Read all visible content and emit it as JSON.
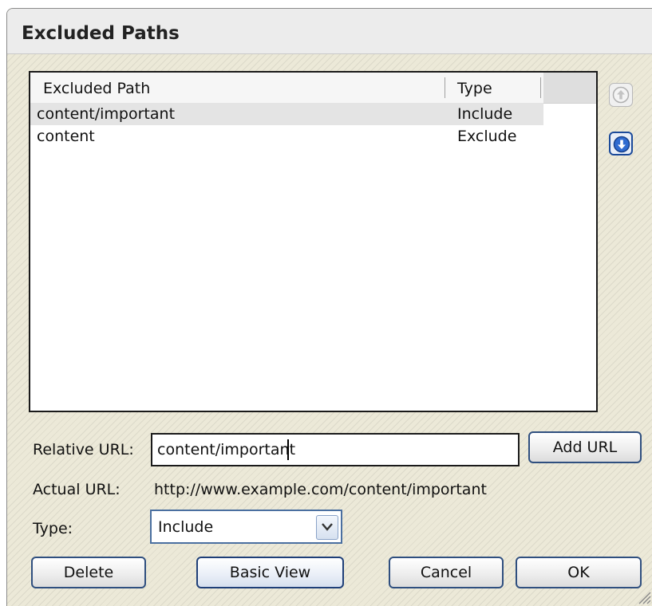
{
  "dialog": {
    "title": "Excluded Paths"
  },
  "list": {
    "columns": [
      "Excluded Path",
      "Type"
    ],
    "rows": [
      {
        "path": "content/important",
        "type": "Include",
        "selected": true
      },
      {
        "path": "content",
        "type": "Exclude",
        "selected": false
      }
    ]
  },
  "buttons": {
    "move_up_icon": "arrow-up-circle-icon",
    "move_down_icon": "arrow-down-circle-icon",
    "add_url": "Add URL",
    "delete": "Delete",
    "basic_view": "Basic View",
    "cancel": "Cancel",
    "ok": "OK"
  },
  "form": {
    "relative_url_label": "Relative URL:",
    "relative_url_value": "content/important",
    "actual_url_label": "Actual URL:",
    "actual_url_value": "http://www.example.com/content/important",
    "type_label": "Type:",
    "type_value": "Include"
  },
  "colors": {
    "accent": "#1b4a9a",
    "dialog_bg": "#ece9d8",
    "selected_row": "#e4e4e4"
  }
}
